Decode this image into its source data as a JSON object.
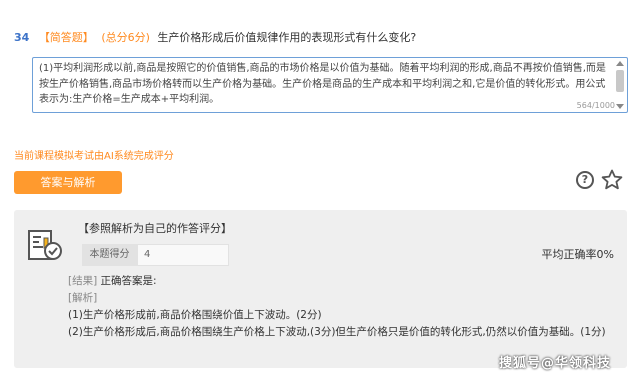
{
  "question": {
    "number": "34",
    "type": "【简答题】",
    "score": "(总分6分)",
    "text": "生产价格形成后价值规律作用的表现形式有什么变化?"
  },
  "answer": {
    "text": "(1)平均利润形成以前,商品是按照它的价值销售,商品的市场价格是以价值为基础。随着平均利润的形成,商品不再按价值销售,而是按生产价格销售,商品市场价格转而以生产价格为基础。生产价格是商品的生产成本和平均利润之和,它是价值的转化形式。用公式表示为:生产价格=生产成本+平均利润。",
    "char_count": "564/1000"
  },
  "ai_note": "当前课程模拟考试由AI系统完成评分",
  "buttons": {
    "analysis": "答案与解析"
  },
  "icons": {
    "help": "?"
  },
  "evaluation": {
    "title": "【参照解析为自己的作答评分】",
    "score_label": "本题得分",
    "score_value": "4",
    "avg_rate": "平均正确率0%",
    "result_tag": "[结果]",
    "result_text": "正确答案是:",
    "analysis_tag": "[解析]",
    "line1": "(1)生产价格形成前,商品价格围绕价值上下波动。(2分)",
    "line2": "(2)生产价格形成后,商品价格围绕生产价格上下波动,(3分)但生产价格只是价值的转化形式,仍然以价值为基础。(1分)"
  },
  "watermark": "搜狐号@华领科技"
}
